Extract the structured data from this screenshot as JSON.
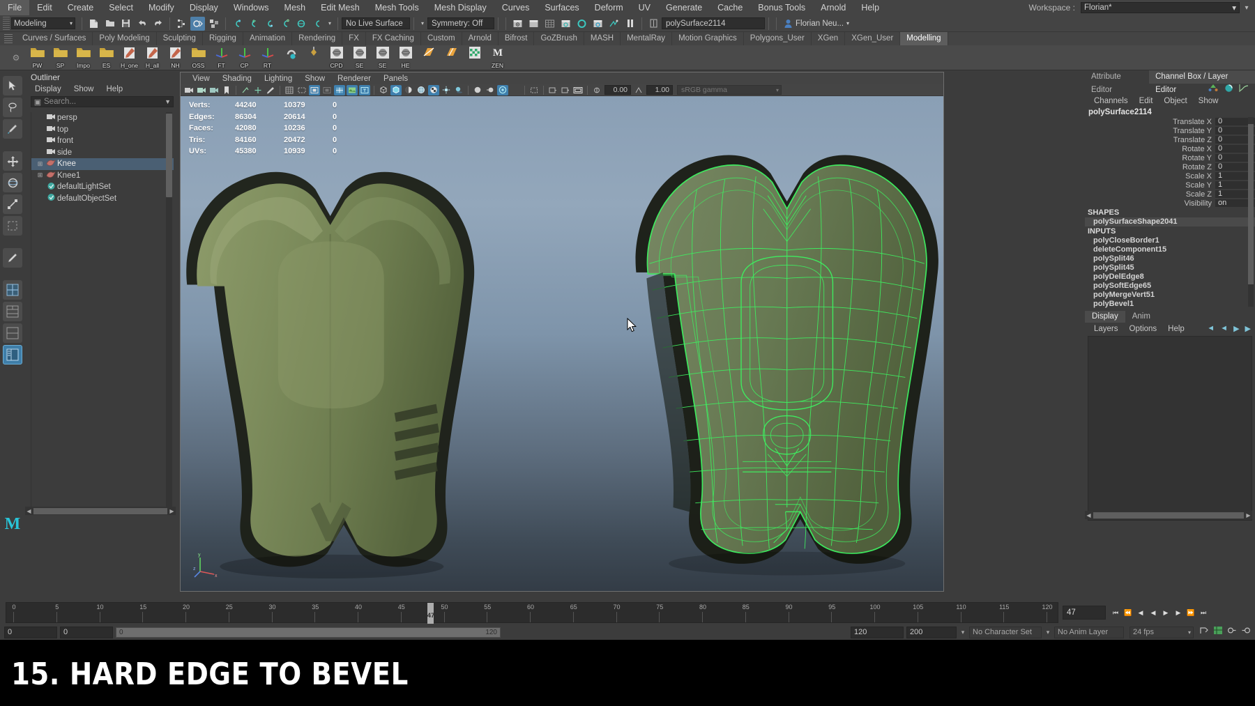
{
  "menubar": {
    "items": [
      "File",
      "Edit",
      "Create",
      "Select",
      "Modify",
      "Display",
      "Windows",
      "Mesh",
      "Edit Mesh",
      "Mesh Tools",
      "Mesh Display",
      "Curves",
      "Surfaces",
      "Deform",
      "UV",
      "Generate",
      "Cache",
      "Bonus Tools",
      "Arnold",
      "Help"
    ],
    "workspace_label": "Workspace :",
    "workspace_value": "Florian*"
  },
  "statusline": {
    "mode": "Modeling",
    "live_surface": "No Live Surface",
    "symmetry": "Symmetry: Off",
    "selected_name": "polySurface2114",
    "user": "Florian Neu...",
    "icons": [
      "new-scene-icon",
      "open-scene-icon",
      "save-scene-icon",
      "undo-icon",
      "redo-icon",
      "select-hierarchy-icon",
      "select-object-icon",
      "select-component-icon",
      "snap-grid-icon",
      "snap-curve-icon",
      "snap-point-icon",
      "snap-projected-icon",
      "snap-view-plane-icon",
      "make-live-icon",
      "show-hide-icon",
      "render-view-icon",
      "render-icon",
      "ipr-render-icon",
      "render-settings-icon",
      "hypershade-icon",
      "pause-icon",
      "input-field-icon"
    ]
  },
  "shelf": {
    "tabs": [
      "Curves / Surfaces",
      "Poly Modeling",
      "Sculpting",
      "Rigging",
      "Animation",
      "Rendering",
      "FX",
      "FX Caching",
      "Custom",
      "Arnold",
      "Bifrost",
      "GoZBrush",
      "MASH",
      "MentalRay",
      "Motion Graphics",
      "Polygons_User",
      "XGen",
      "XGen_User",
      "Modelling"
    ],
    "active_tab": "Modelling",
    "buttons": [
      {
        "label": "PW",
        "icon": "folder-icon"
      },
      {
        "label": "SP",
        "icon": "folder-icon"
      },
      {
        "label": "Impo",
        "icon": "folder-icon"
      },
      {
        "label": "ES",
        "icon": "folder-icon"
      },
      {
        "label": "H_one",
        "icon": "pencil-icon"
      },
      {
        "label": "H_all",
        "icon": "pencil-icon"
      },
      {
        "label": "NH",
        "icon": "pencil-icon"
      },
      {
        "label": "OSS",
        "icon": "folder-icon"
      },
      {
        "label": "FT",
        "icon": "axis-icon"
      },
      {
        "label": "CP",
        "icon": "axis-icon"
      },
      {
        "label": "RT",
        "icon": "axis-icon"
      },
      {
        "label": "",
        "icon": "magnet-icon"
      },
      {
        "label": "",
        "icon": "diamond-icon"
      },
      {
        "label": "CPD",
        "icon": "sphere-icon"
      },
      {
        "label": "SE",
        "icon": "sphere-icon"
      },
      {
        "label": "SE",
        "icon": "sphere-icon"
      },
      {
        "label": "HE",
        "icon": "sphere-icon"
      },
      {
        "label": "",
        "icon": "plane-orange-icon"
      },
      {
        "label": "",
        "icon": "plane-orange2-icon"
      },
      {
        "label": "",
        "icon": "checker-icon"
      },
      {
        "label": "ZEN",
        "icon": "maya-m-icon"
      }
    ]
  },
  "toolbox": {
    "items": [
      {
        "name": "select-tool",
        "icon": "arrow-icon",
        "selected": false
      },
      {
        "name": "lasso-tool",
        "icon": "lasso-icon",
        "selected": false
      },
      {
        "name": "paint-select-tool",
        "icon": "brush-icon",
        "selected": false
      },
      {
        "name": "move-tool",
        "icon": "move-icon",
        "selected": false
      },
      {
        "name": "rotate-tool",
        "icon": "rotate-icon",
        "selected": false
      },
      {
        "name": "scale-tool",
        "icon": "scale-icon",
        "selected": false
      },
      {
        "name": "last-tool",
        "icon": "wrench-icon",
        "selected": false
      },
      {
        "name": "single-view-layout",
        "icon": "layout-single-icon",
        "selected": false
      },
      {
        "name": "four-view-layout",
        "icon": "layout-four-icon",
        "selected": false
      },
      {
        "name": "two-view-layout",
        "icon": "layout-two-icon",
        "selected": false
      },
      {
        "name": "outliner-layout",
        "icon": "layout-outliner-icon",
        "selected": true
      }
    ]
  },
  "outliner": {
    "title": "Outliner",
    "menu": [
      "Display",
      "Show",
      "Help"
    ],
    "search_placeholder": "Search...",
    "items": [
      {
        "label": "persp",
        "icon": "camera-icon",
        "type": "camera",
        "expandable": false,
        "selected": false
      },
      {
        "label": "top",
        "icon": "camera-icon",
        "type": "camera",
        "expandable": false,
        "selected": false
      },
      {
        "label": "front",
        "icon": "camera-icon",
        "type": "camera",
        "expandable": false,
        "selected": false
      },
      {
        "label": "side",
        "icon": "camera-icon",
        "type": "camera",
        "expandable": false,
        "selected": false
      },
      {
        "label": "Knee",
        "icon": "mesh-icon",
        "type": "mesh",
        "expandable": true,
        "selected": true
      },
      {
        "label": "Knee1",
        "icon": "mesh-icon",
        "type": "mesh",
        "expandable": true,
        "selected": false
      },
      {
        "label": "defaultLightSet",
        "icon": "set-icon",
        "type": "set",
        "expandable": false,
        "selected": false
      },
      {
        "label": "defaultObjectSet",
        "icon": "set-icon",
        "type": "set",
        "expandable": false,
        "selected": false
      }
    ]
  },
  "viewport": {
    "menu": [
      "View",
      "Shading",
      "Lighting",
      "Show",
      "Renderer",
      "Panels"
    ],
    "num_fields": [
      "0.00",
      "1.00"
    ],
    "colorspace": "sRGB gamma",
    "hud": {
      "rows": [
        {
          "label": "Verts:",
          "total": "44240",
          "selected": "10379",
          "extra": "0"
        },
        {
          "label": "Edges:",
          "total": "86304",
          "selected": "20614",
          "extra": "0"
        },
        {
          "label": "Faces:",
          "total": "42080",
          "selected": "10236",
          "extra": "0"
        },
        {
          "label": "Tris:",
          "total": "84160",
          "selected": "20472",
          "extra": "0"
        },
        {
          "label": "UVs:",
          "total": "45380",
          "selected": "10939",
          "extra": "0"
        }
      ]
    },
    "axis": {
      "x": "x",
      "y": "y",
      "z": "z"
    },
    "model_color": "#7d8c5a",
    "wireframe_color": "#44ee55"
  },
  "right_panel": {
    "tabs": [
      "Attribute Editor",
      "Channel Box / Layer Editor"
    ],
    "active_tab": "Channel Box / Layer Editor",
    "cb_menu": [
      "Channels",
      "Edit",
      "Object",
      "Show"
    ],
    "node_name": "polySurface2114",
    "attributes": [
      {
        "key": "Translate X",
        "value": "0"
      },
      {
        "key": "Translate Y",
        "value": "0"
      },
      {
        "key": "Translate Z",
        "value": "0"
      },
      {
        "key": "Rotate X",
        "value": "0"
      },
      {
        "key": "Rotate Y",
        "value": "0"
      },
      {
        "key": "Rotate Z",
        "value": "0"
      },
      {
        "key": "Scale X",
        "value": "1"
      },
      {
        "key": "Scale Y",
        "value": "1"
      },
      {
        "key": "Scale Z",
        "value": "1"
      },
      {
        "key": "Visibility",
        "value": "on"
      }
    ],
    "shapes_header": "SHAPES",
    "shapes": [
      "polySurfaceShape2041"
    ],
    "inputs_header": "INPUTS",
    "inputs": [
      "polyCloseBorder1",
      "deleteComponent15",
      "polySplit46",
      "polySplit45",
      "polyDelEdge8",
      "polySoftEdge65",
      "polyMergeVert51",
      "polyBevel1"
    ],
    "layer_tabs": [
      "Display",
      "Anim"
    ],
    "active_layer_tab": "Display",
    "layer_menu": [
      "Layers",
      "Options",
      "Help"
    ]
  },
  "timeline": {
    "ticks": [
      "0",
      "5",
      "10",
      "15",
      "20",
      "25",
      "30",
      "35",
      "40",
      "45",
      "50",
      "55",
      "60",
      "65",
      "70",
      "75",
      "80",
      "85",
      "90",
      "95",
      "100",
      "105",
      "110",
      "115",
      "120"
    ],
    "current_frame": "47",
    "frame_field": "47",
    "transport_icons": [
      "go-to-start-icon",
      "step-back-key-icon",
      "step-back-frame-icon",
      "play-backwards-icon",
      "play-forwards-icon",
      "step-forward-frame-icon",
      "step-forward-key-icon",
      "go-to-end-icon"
    ]
  },
  "range_bar": {
    "start_field": "0",
    "anim_start": "0",
    "range_start": "0",
    "range_end": "120",
    "anim_end": "120",
    "playback_end": "200",
    "character_set": "No Character Set",
    "anim_layer": "No Anim Layer",
    "fps": "24 fps"
  },
  "caption": {
    "text": "15. HARD EDGE TO BEVEL"
  }
}
